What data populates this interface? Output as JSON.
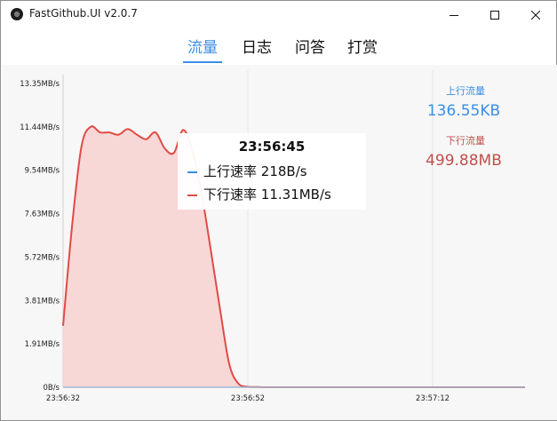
{
  "window": {
    "title": "FastGithub.UI v2.0.7",
    "controls": [
      "minimize-icon",
      "maximize-icon",
      "close-icon"
    ]
  },
  "tabs": [
    {
      "label": "流量",
      "active": true
    },
    {
      "label": "日志",
      "active": false
    },
    {
      "label": "问答",
      "active": false
    },
    {
      "label": "打赏",
      "active": false
    }
  ],
  "stats": {
    "upload": {
      "label": "上行流量",
      "value": "136.55KB",
      "color": "#3a8ee6"
    },
    "download": {
      "label": "下行流量",
      "value": "499.88MB",
      "color": "#c0504d"
    }
  },
  "tooltip": {
    "time": "23:56:45",
    "upload": {
      "label": "上行速率",
      "value": "218B/s",
      "color": "#3a8ee6"
    },
    "download": {
      "label": "下行速率",
      "value": "11.31MB/s",
      "color": "#e04b45"
    }
  },
  "chart_data": {
    "type": "area",
    "x_unit": "seconds",
    "y_ticks": [
      "0B/s",
      "1.91MB/s",
      "3.81MB/s",
      "5.72MB/s",
      "7.63MB/s",
      "9.54MB/s",
      "11.44MB/s",
      "13.35MB/s"
    ],
    "y_tick_values": [
      0,
      1.91,
      3.81,
      5.72,
      7.63,
      9.54,
      11.44,
      13.35
    ],
    "x_ticks": [
      "23:56:32",
      "23:56:52",
      "23:57:12"
    ],
    "ylim": [
      0,
      13.35
    ],
    "grid": "vertical",
    "series": [
      {
        "name": "下行速率",
        "color": "#e04b45",
        "fill": "#f8d7d7",
        "x": [
          "23:56:32",
          "23:56:33",
          "23:56:34",
          "23:56:35",
          "23:56:36",
          "23:56:37",
          "23:56:38",
          "23:56:39",
          "23:56:40",
          "23:56:41",
          "23:56:42",
          "23:56:43",
          "23:56:44",
          "23:56:45",
          "23:56:46",
          "23:56:47",
          "23:56:48",
          "23:56:49",
          "23:56:50",
          "23:56:51",
          "23:56:52",
          "23:56:53",
          "23:56:54",
          "23:56:55",
          "23:56:56",
          "23:56:57",
          "23:56:58",
          "23:56:59",
          "23:57:00",
          "23:57:10",
          "23:57:20",
          "23:57:22"
        ],
        "values": [
          2.7,
          7.2,
          10.6,
          11.45,
          11.2,
          11.2,
          11.1,
          11.35,
          11.1,
          10.9,
          11.2,
          10.5,
          10.3,
          11.31,
          10.4,
          8.5,
          6.0,
          3.4,
          1.0,
          0.15,
          0.02,
          0.01,
          0,
          0,
          0,
          0,
          0,
          0,
          0,
          0,
          0,
          0
        ]
      },
      {
        "name": "上行速率",
        "color": "#3a8ee6",
        "values": [
          0.0002,
          0.0002,
          0.0002,
          0.0002,
          0.0002,
          0.0002,
          0.0002,
          0.0002,
          0.0002,
          0.0002,
          0.0002,
          0.0002,
          0.0002,
          0.0002,
          0.0002,
          0.0002,
          0.0002,
          0.0002,
          0.0002,
          0.0002,
          0.0002,
          0.0002,
          0,
          0,
          0,
          0,
          0,
          0,
          0,
          0,
          0,
          0
        ]
      }
    ]
  }
}
